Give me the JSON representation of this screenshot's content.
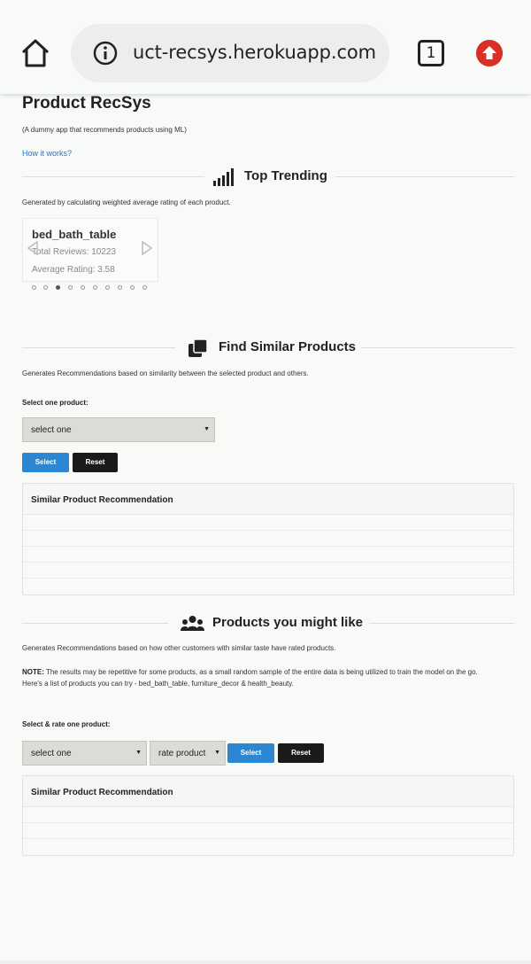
{
  "browser": {
    "url": "uct-recsys.herokuapp.com",
    "tab_count": "1",
    "icons": [
      "home-icon",
      "info-icon",
      "tabs-icon",
      "update-icon"
    ]
  },
  "app": {
    "title": "Product RecSys",
    "subtitle": "(A dummy app that recommends products using ML)",
    "how_link": "How it works?"
  },
  "trending": {
    "title": "Top Trending",
    "icon": "signal-bars-icon",
    "description": "Generated by calculating weighted average rating of each product.",
    "card": {
      "name": "bed_bath_table",
      "reviews": "Total Reviews: 10223",
      "rating": "Average Rating: 3.58"
    },
    "active_dot": 2,
    "dot_count": 11
  },
  "similar": {
    "title": "Find Similar Products",
    "icon": "copy-squares-icon",
    "description": "Generates Recommendations based on similarity between the selected product and others.",
    "select_label": "Select one product:",
    "select_value": "select one",
    "select_button": "Select",
    "reset_button": "Reset",
    "table_header": "Similar Product Recommendation"
  },
  "might_like": {
    "title": "Products you might like",
    "icon": "users-icon",
    "description": "Generates Recommendations based on how other customers with similar taste have rated products.",
    "note_label": "NOTE:",
    "note_text": " The results may be repetitive for some products, as a small random sample of the entire data is being utilized to train the model on the go.",
    "note_list": "Here's a list of products you can try - bed_bath_table, furniture_decor & health_beauty.",
    "select_label": "Select & rate one product:",
    "select_value": "select one",
    "rate_value": "rate product",
    "select_button": "Select",
    "reset_button": "Reset",
    "table_header": "Similar Product Recommendation"
  },
  "colors": {
    "primary_button": "#2b87d1",
    "dark_button": "#1a1a1a",
    "link": "#2a72c8",
    "update_badge": "#d93025"
  }
}
